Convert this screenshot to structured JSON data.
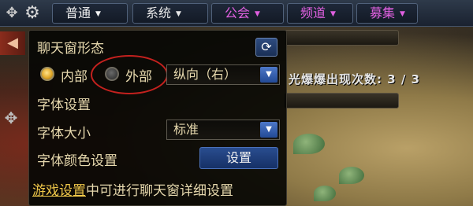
{
  "topbar": {
    "move_icon": "✥",
    "gear_icon": "⚙",
    "tabs": [
      {
        "label": "普通"
      },
      {
        "label": "系统"
      },
      {
        "label": "公会"
      },
      {
        "label": "频道"
      },
      {
        "label": "募集"
      }
    ],
    "caret": "▼"
  },
  "background": {
    "drop_counter": "光爆爆出现次数: 3 / 3"
  },
  "panel": {
    "chat_window_mode_label": "聊天窗形态",
    "refresh_icon": "⟳",
    "radio_internal_label": "内部",
    "radio_external_label": "外部",
    "selected_mode": "internal",
    "orientation_value": "纵向（右）",
    "font_settings_label": "字体设置",
    "font_size_label": "字体大小",
    "font_size_value": "标准",
    "font_color_label": "字体颜色设置",
    "setup_button_label": "设置",
    "footer_link": "游戏设置",
    "footer_text": "中可进行聊天窗详细设置",
    "dropdown_arrow": "▼"
  },
  "colors": {
    "panel_text": "#e7d9ae",
    "guild_tab": "#e060e0",
    "link": "#f0c84a",
    "highlight_ring": "#c4211e",
    "button_blue": "#294d8f"
  }
}
